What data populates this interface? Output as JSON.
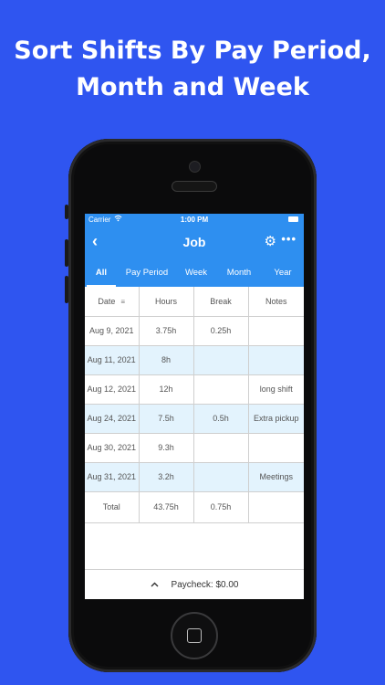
{
  "headline": {
    "line1": "Sort Shifts By Pay Period,",
    "line2": "Month and Week"
  },
  "status_bar": {
    "carrier": "Carrier",
    "time": "1:00 PM",
    "wifi_icon": "wifi-icon",
    "battery_icon": "battery-icon"
  },
  "nav": {
    "title": "Job",
    "back_icon": "chevron-left-icon",
    "settings_icon": "gear-icon",
    "more_icon": "more-icon"
  },
  "tabs": [
    {
      "label": "All",
      "active": true
    },
    {
      "label": "Pay Period"
    },
    {
      "label": "Week"
    },
    {
      "label": "Month"
    },
    {
      "label": "Year"
    }
  ],
  "table": {
    "headers": [
      "Date",
      "Hours",
      "Break",
      "Notes"
    ],
    "rows": [
      {
        "date": "Aug 9, 2021",
        "hours": "3.75h",
        "break": "0.25h",
        "notes": ""
      },
      {
        "date": "Aug 11, 2021",
        "hours": "8h",
        "break": "",
        "notes": ""
      },
      {
        "date": "Aug 12, 2021",
        "hours": "12h",
        "break": "",
        "notes": "long shift"
      },
      {
        "date": "Aug 24, 2021",
        "hours": "7.5h",
        "break": "0.5h",
        "notes": "Extra pickup"
      },
      {
        "date": "Aug 30, 2021",
        "hours": "9.3h",
        "break": "",
        "notes": ""
      },
      {
        "date": "Aug 31, 2021",
        "hours": "3.2h",
        "break": "",
        "notes": "Meetings"
      }
    ],
    "total": {
      "label": "Total",
      "hours": "43.75h",
      "break": "0.75h",
      "notes": ""
    }
  },
  "footer": {
    "paycheck": "Paycheck: $0.00",
    "expand_icon": "chevron-up-icon"
  },
  "colors": {
    "background": "#2f55f0",
    "app_bar": "#2e8ff0",
    "row_shade": "#e3f3fd"
  }
}
